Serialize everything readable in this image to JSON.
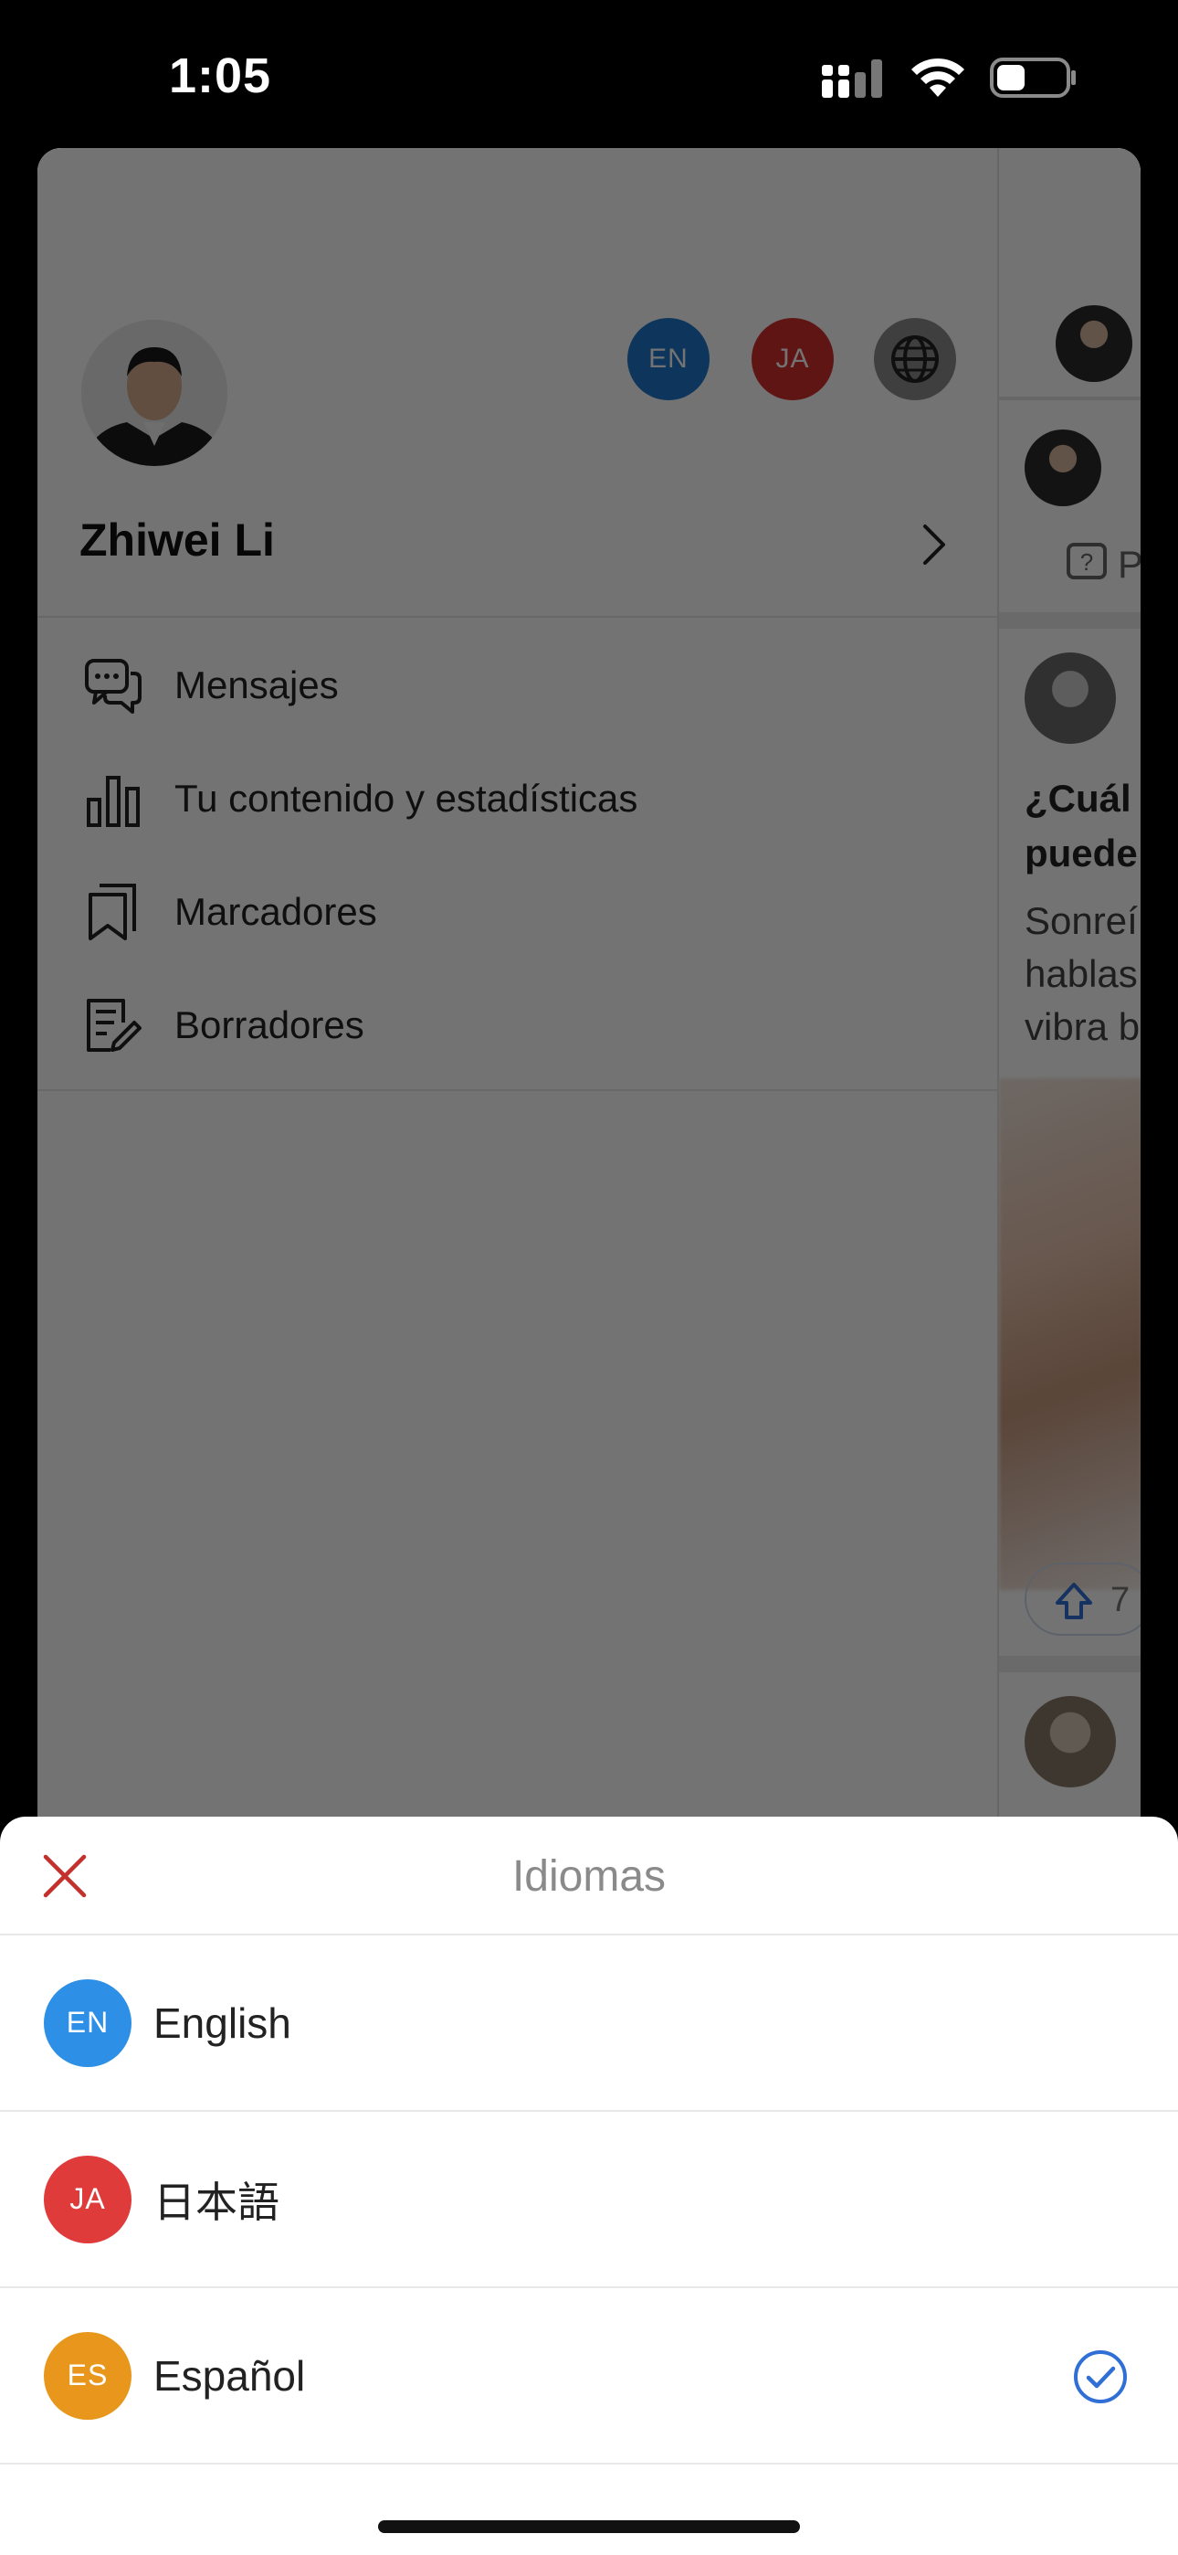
{
  "status_bar": {
    "time": "1:05"
  },
  "drawer": {
    "profile_name": "Zhiwei Li",
    "language_pills": [
      {
        "code": "EN",
        "color": "#1f77c9"
      },
      {
        "code": "JA",
        "color": "#d62f2f"
      }
    ],
    "menu": [
      {
        "label": "Mensajes",
        "icon": "chat-bubbles-icon"
      },
      {
        "label": "Tu contenido y estadísticas",
        "icon": "bar-chart-icon"
      },
      {
        "label": "Marcadores",
        "icon": "bookmarks-icon"
      },
      {
        "label": "Borradores",
        "icon": "drafts-icon"
      }
    ]
  },
  "feed_peek": {
    "question_label": "P",
    "headline_1": "¿Cuál",
    "headline_2": "puede",
    "snippet_1": "Sonreí",
    "snippet_2": "hablas",
    "snippet_3": "vibra b",
    "upvote_count": "7"
  },
  "sheet": {
    "title": "Idiomas",
    "languages": [
      {
        "code": "EN",
        "name": "English",
        "color": "#2d8fe6",
        "selected": false
      },
      {
        "code": "JA",
        "name": "日本語",
        "color": "#e03b3b",
        "selected": false
      },
      {
        "code": "ES",
        "name": "Español",
        "color": "#e8961c",
        "selected": true
      }
    ],
    "accent_close": "#c4302b",
    "accent_check": "#2f6fd6"
  }
}
